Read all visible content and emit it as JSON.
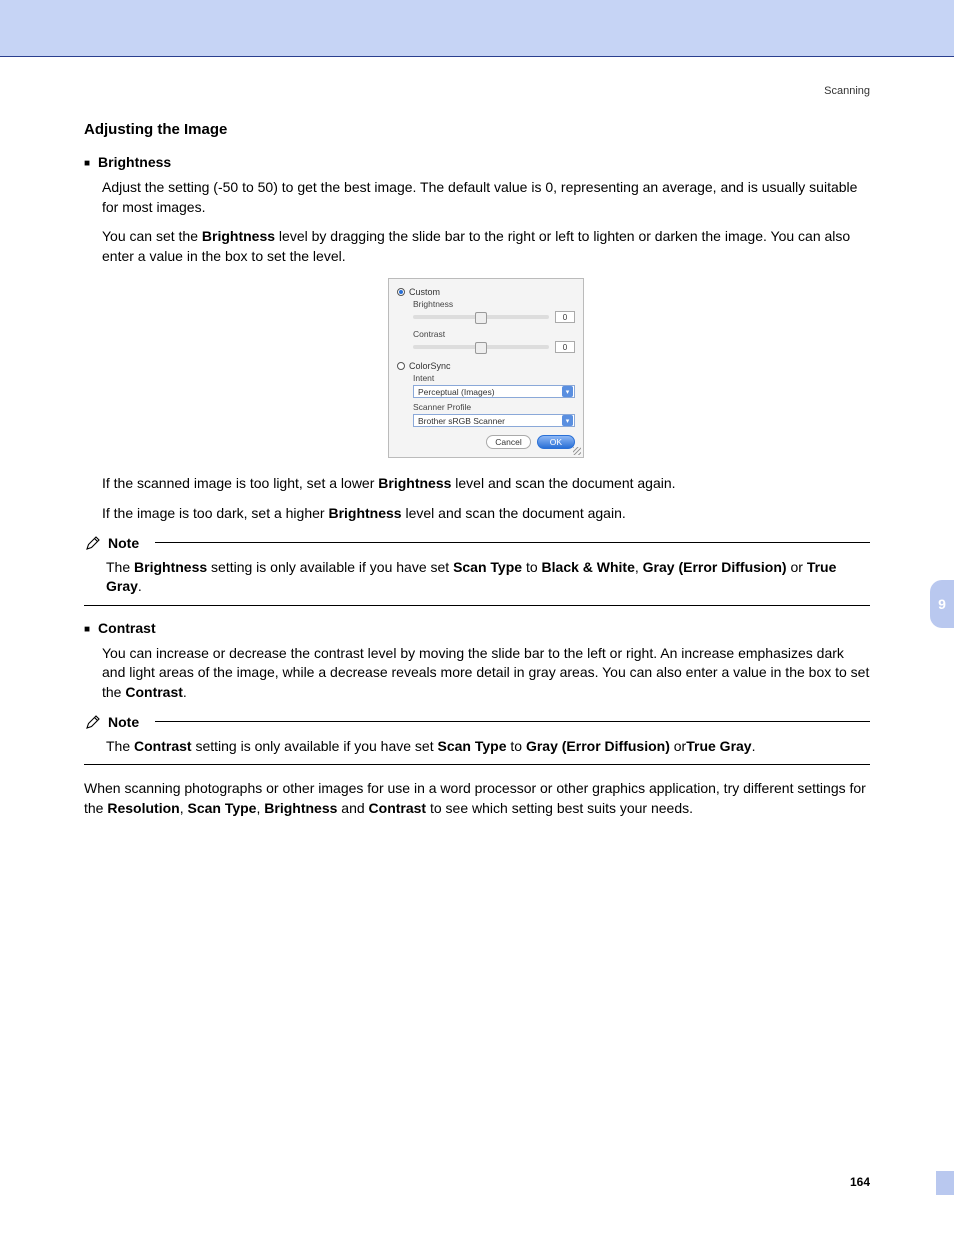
{
  "header": {
    "section": "Scanning"
  },
  "page": {
    "number": "164",
    "chapter": "9"
  },
  "h2": "Adjusting the Image",
  "brightness": {
    "title": "Brightness",
    "p1_a": "Adjust the setting (-50 to 50) to get the best image. The default value is 0, representing an average, and is usually suitable for most images.",
    "p2_a": "You can set the ",
    "p2_b": "Brightness",
    "p2_c": " level by dragging the slide bar to the right or left to lighten or darken the image. You can also enter a value in the box to set the level.",
    "p3_a": "If the scanned image is too light, set a lower ",
    "p3_b": "Brightness",
    "p3_c": " level and scan the document again.",
    "p4_a": "If the image is too dark, set a higher ",
    "p4_b": "Brightness",
    "p4_c": " level and scan the document again."
  },
  "note1": {
    "title": "Note",
    "a": "The ",
    "b": "Brightness",
    "c": " setting is only available if you have set ",
    "d": "Scan Type",
    "e": " to ",
    "f": "Black & White",
    "g": ", ",
    "h": "Gray (Error Diffusion)",
    "i": " or ",
    "j": "True Gray",
    "k": "."
  },
  "contrast": {
    "title": "Contrast",
    "p1_a": "You can increase or decrease the contrast level by moving the slide bar to the left or right. An increase emphasizes dark and light areas of the image, while a decrease reveals more detail in gray areas. You can also enter a value in the box to set the ",
    "p1_b": "Contrast",
    "p1_c": "."
  },
  "note2": {
    "title": "Note",
    "a": "The ",
    "b": "Contrast",
    "c": " setting is only available if you have set ",
    "d": "Scan Type",
    "e": " to ",
    "f": "Gray (Error Diffusion)",
    "g": " or",
    "h": "True Gray",
    "i": "."
  },
  "closing": {
    "a": "When scanning photographs or other images for use in a word processor or other graphics application, try different settings for the ",
    "b": "Resolution",
    "c": ", ",
    "d": "Scan Type",
    "e": ", ",
    "f": "Brightness",
    "g": " and ",
    "h": "Contrast",
    "i": " to see which setting best suits your needs."
  },
  "dialog": {
    "custom": "Custom",
    "brightness": "Brightness",
    "brightness_val": "0",
    "contrast": "Contrast",
    "contrast_val": "0",
    "colorsync": "ColorSync",
    "intent": "Intent",
    "intent_val": "Perceptual (Images)",
    "profile": "Scanner Profile",
    "profile_val": "Brother sRGB Scanner",
    "cancel": "Cancel",
    "ok": "OK"
  }
}
